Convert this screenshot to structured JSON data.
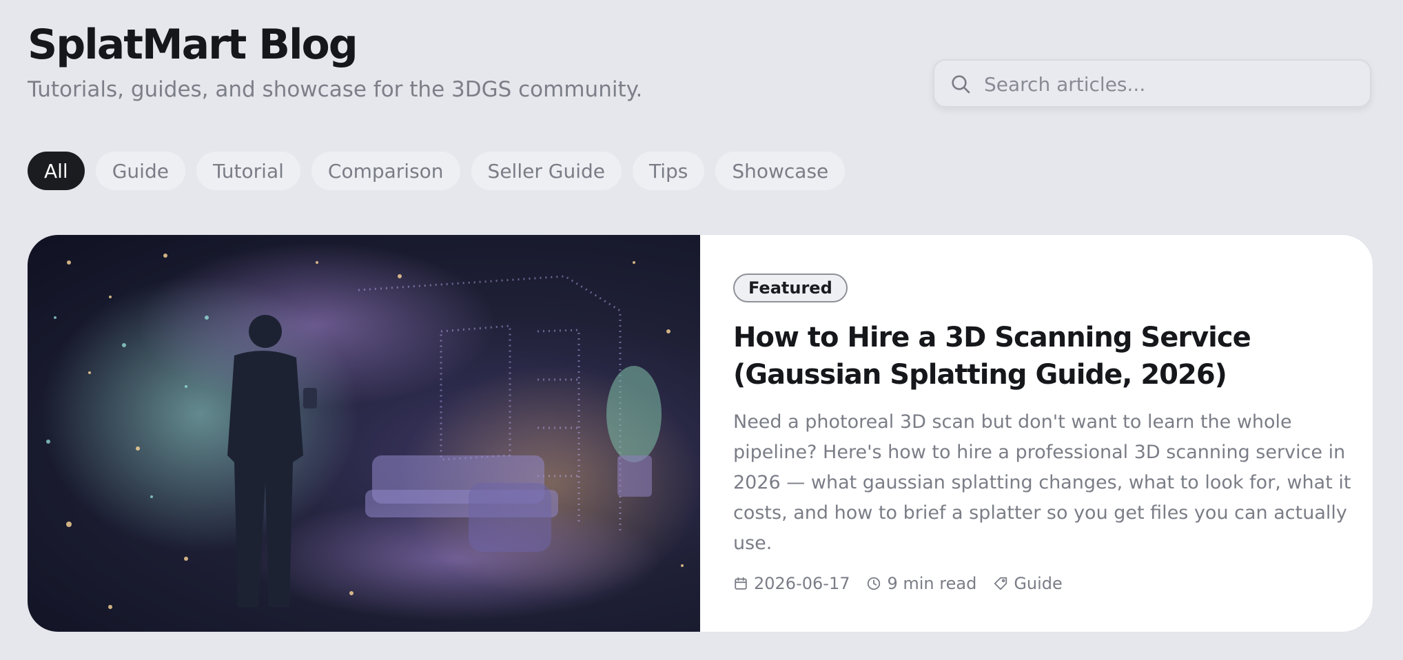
{
  "header": {
    "title": "SplatMart Blog",
    "subtitle": "Tutorials, guides, and showcase for the 3DGS community."
  },
  "search": {
    "placeholder": "Search articles...",
    "icon": "search-icon"
  },
  "filters": [
    {
      "label": "All",
      "active": true
    },
    {
      "label": "Guide",
      "active": false
    },
    {
      "label": "Tutorial",
      "active": false
    },
    {
      "label": "Comparison",
      "active": false
    },
    {
      "label": "Seller Guide",
      "active": false
    },
    {
      "label": "Tips",
      "active": false
    },
    {
      "label": "Showcase",
      "active": false
    }
  ],
  "featured": {
    "badge": "Featured",
    "title": "How to Hire a 3D Scanning Service (Gaussian Splatting Guide, 2026)",
    "excerpt": "Need a photoreal 3D scan but don't want to learn the whole pipeline? Here's how to hire a professional 3D scanning service in 2026 — what gaussian splatting changes, what to look for, what it costs, and how to brief a splatter so you get files you can actually use.",
    "date": "2026-06-17",
    "read_time": "9 min read",
    "tag": "Guide",
    "icons": {
      "date": "calendar-icon",
      "read_time": "clock-icon",
      "tag": "tag-icon"
    }
  },
  "colors": {
    "background": "#e6e7ec",
    "active_chip": "#1b1c20",
    "muted_text": "#7a7d86"
  }
}
